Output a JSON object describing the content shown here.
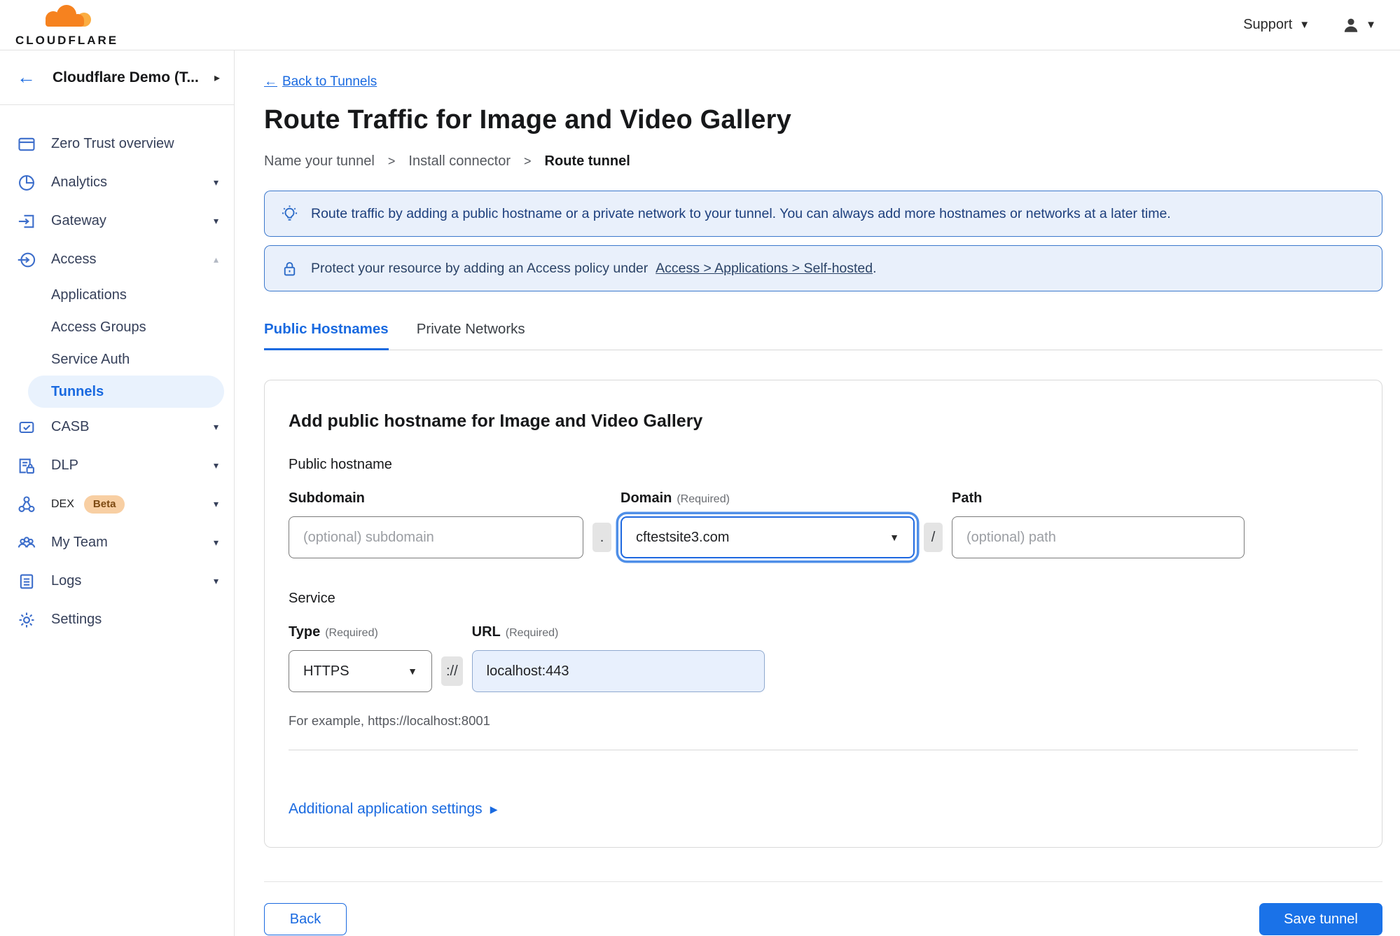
{
  "colors": {
    "accent_blue": "#1a6ae0",
    "save_button_blue": "#1a72e8",
    "banner_background": "#e9f0fb",
    "banner_border": "#3c78cc",
    "banner_tip_text": "#1d3f7d",
    "active_pill_background": "#e9f2fd",
    "sidebar_text": "#36405a",
    "sidebar_icon_blue": "#3d6ecb",
    "beta_badge_background": "#f8cfa3",
    "beta_badge_text": "#7d4a12",
    "url_field_fill": "#e8f0fd",
    "logo_orange": "#f6821f",
    "logo_light_orange": "#fbad41"
  },
  "icons": {
    "arrow_left": "←",
    "caret_down": "▾",
    "caret_up": "▴",
    "chevron_right_small": "▸",
    "select_caret": "▼",
    "triangle_right": "▶",
    "step_separator": ">"
  },
  "topbar": {
    "logo_text": "CLOUDFLARE",
    "support_label": "Support"
  },
  "sidebar": {
    "account_label": "Cloudflare Demo (T...",
    "items": [
      {
        "label": "Zero Trust overview"
      },
      {
        "label": "Analytics"
      },
      {
        "label": "Gateway"
      },
      {
        "label": "Access",
        "children": [
          "Applications",
          "Access Groups",
          "Service Auth",
          "Tunnels"
        ]
      },
      {
        "label": "CASB"
      },
      {
        "label": "DLP"
      },
      {
        "label": "DEX",
        "badge": "Beta"
      },
      {
        "label": "My Team"
      },
      {
        "label": "Logs"
      },
      {
        "label": "Settings"
      }
    ],
    "active_subitem": "Tunnels"
  },
  "page": {
    "back_link": "Back to Tunnels",
    "title": "Route Traffic for Image and Video Gallery",
    "steps": [
      "Name your tunnel",
      "Install connector",
      "Route tunnel"
    ],
    "banner_tip": "Route traffic by adding a public hostname or a private network to your tunnel. You can always add more hostnames or networks at a later time.",
    "banner_protect_prefix": "Protect your resource by adding an Access policy under",
    "banner_protect_link": "Access > Applications > Self-hosted",
    "banner_protect_suffix": ".",
    "tabs": [
      "Public Hostnames",
      "Private Networks"
    ]
  },
  "form": {
    "heading": "Add public hostname for Image and Video Gallery",
    "public_hostname_label": "Public hostname",
    "subdomain_label": "Subdomain",
    "subdomain_placeholder": "(optional) subdomain",
    "dot": ".",
    "domain_label": "Domain",
    "required": "(Required)",
    "domain_value": "cftestsite3.com",
    "slash": "/",
    "path_label": "Path",
    "path_placeholder": "(optional) path",
    "service_label": "Service",
    "type_label": "Type",
    "type_value": "HTTPS",
    "scheme_separator": "://",
    "url_label": "URL",
    "url_value": "localhost:443",
    "example": "For example, https://localhost:8001",
    "additional_settings": "Additional application settings"
  },
  "footer": {
    "back": "Back",
    "save": "Save tunnel"
  }
}
